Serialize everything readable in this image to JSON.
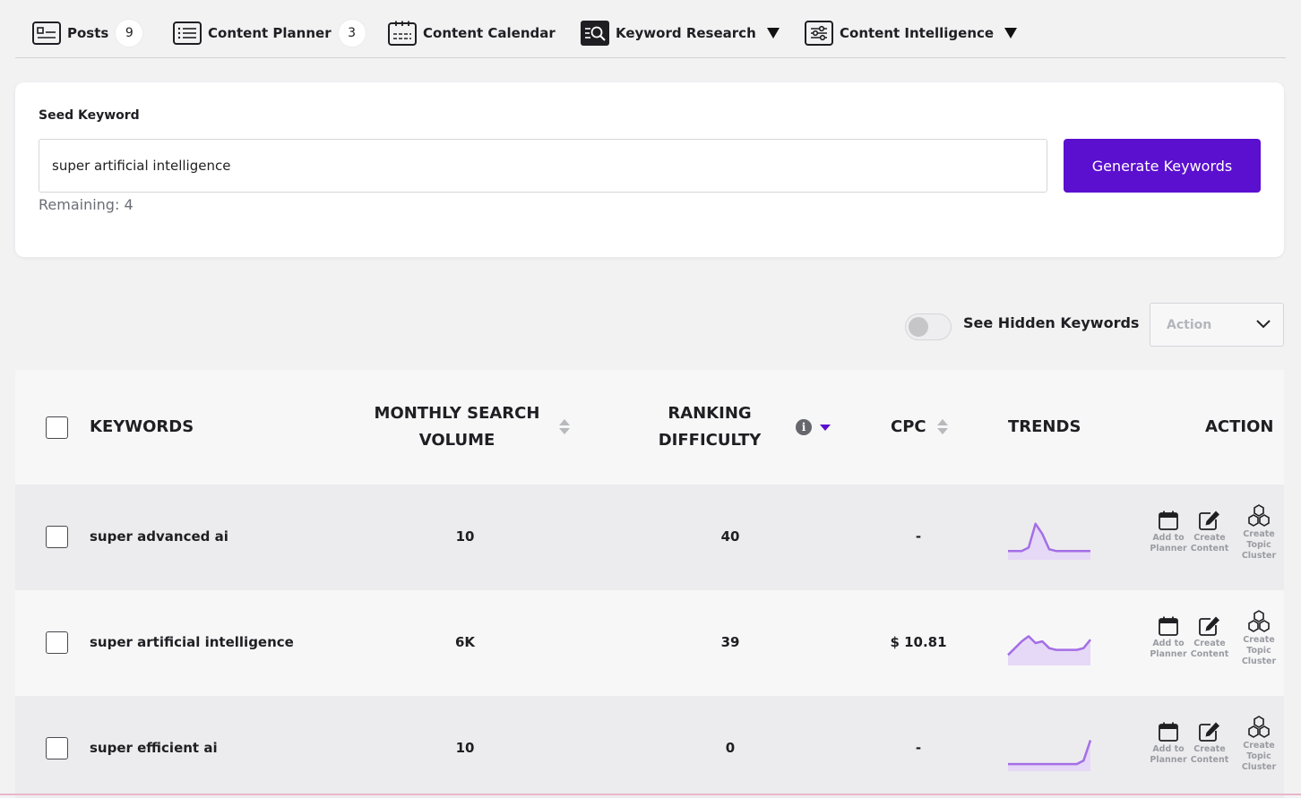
{
  "nav": {
    "items": [
      {
        "label": "Posts",
        "badge": "9",
        "icon": "posts-icon"
      },
      {
        "label": "Content Planner",
        "badge": "3",
        "icon": "list-icon"
      },
      {
        "label": "Content Calendar",
        "icon": "calendar-icon"
      },
      {
        "label": "Keyword Research",
        "icon": "keyword-search-icon",
        "dropdown": true
      },
      {
        "label": "Content Intelligence",
        "icon": "sliders-icon",
        "dropdown": true
      }
    ]
  },
  "seed": {
    "label": "Seed Keyword",
    "value": "super artificial intelligence",
    "remaining": "Remaining: 4",
    "button": "Generate Keywords"
  },
  "toolbar": {
    "hidden_label": "See Hidden Keywords",
    "hidden_toggle_on": false,
    "action_placeholder": "Action"
  },
  "table": {
    "headers": {
      "keywords": "KEYWORDS",
      "volume_line1": "MONTHLY SEARCH",
      "volume_line2": "VOLUME",
      "difficulty_line1": "RANKING",
      "difficulty_line2": "DIFFICULTY",
      "cpc": "CPC",
      "trends": "TRENDS",
      "action": "ACTION"
    },
    "rows": [
      {
        "keyword": "super advanced ai",
        "volume": "10",
        "difficulty": "40",
        "cpc": "-",
        "trend": [
          0.1,
          0.1,
          0.1,
          0.2,
          0.9,
          0.6,
          0.15,
          0.1,
          0.1,
          0.1,
          0.1,
          0.1,
          0.1
        ]
      },
      {
        "keyword": "super artificial intelligence",
        "volume": "6K",
        "difficulty": "39",
        "cpc": "$ 10.81",
        "trend": [
          0.15,
          0.35,
          0.55,
          0.7,
          0.5,
          0.55,
          0.35,
          0.3,
          0.3,
          0.3,
          0.3,
          0.35,
          0.6
        ]
      },
      {
        "keyword": "super efficient ai",
        "volume": "10",
        "difficulty": "0",
        "cpc": "-",
        "trend": [
          0.05,
          0.05,
          0.05,
          0.05,
          0.05,
          0.05,
          0.05,
          0.05,
          0.05,
          0.05,
          0.05,
          0.15,
          0.75
        ]
      }
    ],
    "actions": {
      "add_line1": "Add to",
      "add_line2": "Planner",
      "create_line1": "Create",
      "create_line2": "Content",
      "cluster_line1": "Create",
      "cluster_line2": "Topic",
      "cluster_line3": "Cluster"
    }
  },
  "colors": {
    "accent": "#5b0fcf",
    "trend_line": "#a46ee6",
    "trend_fill": "#e6d8f7"
  }
}
